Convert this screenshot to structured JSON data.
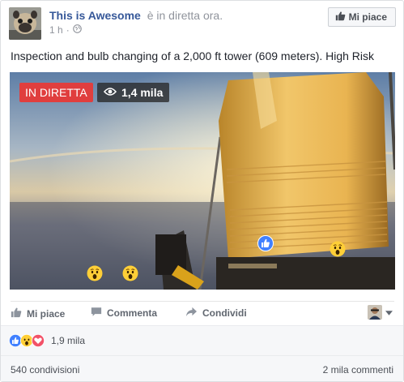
{
  "post": {
    "page_name": "This is Awesome",
    "live_status": "è in diretta ora.",
    "time": "1 h",
    "time_separator": "·",
    "like_page_label": "Mi piace",
    "text": "Inspection and bulb changing of a 2,000 ft tower (609 meters). High Risk"
  },
  "video": {
    "live_badge": "IN DIRETTA",
    "viewers": "1,4 mila"
  },
  "actions": {
    "like": "Mi piace",
    "comment": "Commenta",
    "share": "Condividi"
  },
  "reactions": {
    "count": "1,9 mila",
    "types": [
      "like",
      "wow",
      "love"
    ]
  },
  "footer": {
    "shares": "540 condivisioni",
    "comments": "2 mila commenti"
  },
  "colors": {
    "link": "#365899",
    "live_red": "#e03e3e",
    "like_blue": "#4080ff",
    "wow_yellow": "#ffcf37",
    "love_red": "#f25268"
  }
}
